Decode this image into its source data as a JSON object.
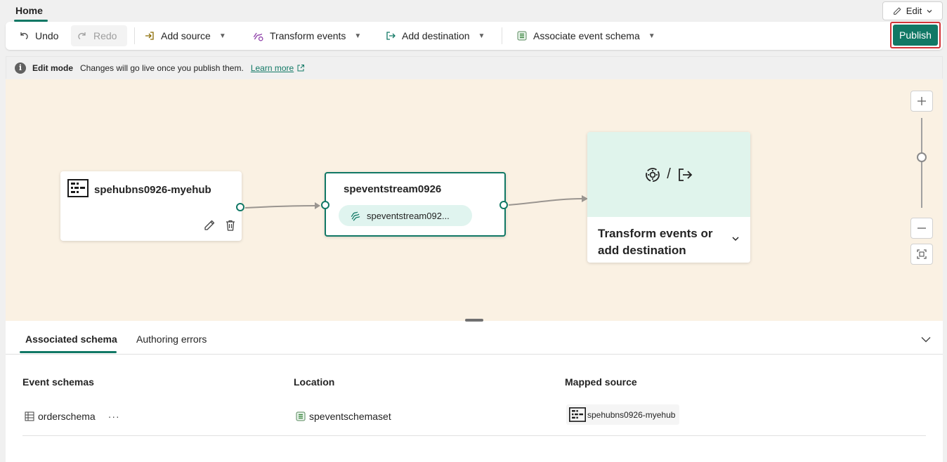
{
  "tabs": {
    "home": "Home"
  },
  "edit_menu": {
    "label": "Edit"
  },
  "toolbar": {
    "undo": "Undo",
    "redo": "Redo",
    "add_source": "Add source",
    "transform_events": "Transform events",
    "add_destination": "Add destination",
    "associate_event_schema": "Associate event schema",
    "publish": "Publish"
  },
  "infobar": {
    "title": "Edit mode",
    "message": "Changes will go live once you publish them.",
    "link": "Learn more"
  },
  "canvas": {
    "source_node": {
      "title": "spehubns0926-myehub"
    },
    "stream_node": {
      "title": "speventstream0926",
      "pill": "speventstream092..."
    },
    "destination_node": {
      "label": "Transform events or add destination",
      "separator": "/"
    }
  },
  "panel": {
    "tabs": [
      "Associated schema",
      "Authoring errors"
    ],
    "columns": [
      "Event schemas",
      "Location",
      "Mapped source"
    ],
    "rows": [
      {
        "schema": "orderschema",
        "location": "speventschemaset",
        "mapped_source": "spehubns0926-myehub"
      }
    ]
  },
  "colors": {
    "accent": "#117865",
    "canvas": "#faf1e3",
    "highlight": "#d13438"
  }
}
